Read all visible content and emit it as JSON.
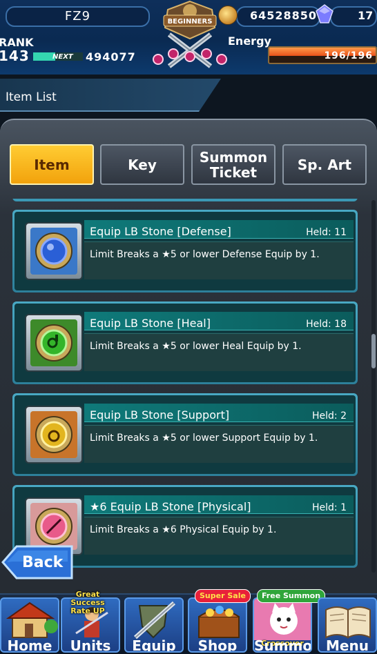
{
  "header": {
    "player_name": "FZ9",
    "emblem_text": "BEGINNERS",
    "coins": "64528850",
    "gems": "17",
    "rank_label": "RANK",
    "rank_value": "143",
    "next_label": "NEXT",
    "next_value": "494077",
    "next_progress": 0.45,
    "energy_label": "Energy",
    "energy_value": "196/196",
    "energy_progress": 1.0
  },
  "title": "Item List",
  "tabs": [
    {
      "label": "Item",
      "active": true
    },
    {
      "label": "Key",
      "active": false
    },
    {
      "label": "Summon\nTicket",
      "active": false
    },
    {
      "label": "Sp. Art",
      "active": false
    }
  ],
  "items": [
    {
      "name": "Equip LB Stone [Defense]",
      "held": "Held: 11",
      "desc": "Limit Breaks a ★5 or lower Defense Equip by 1.",
      "icon": "blue-stone-icon",
      "color": "#2a5fd6"
    },
    {
      "name": "Equip LB Stone [Heal]",
      "held": "Held: 18",
      "desc": "Limit Breaks a ★5 or lower Heal Equip by 1.",
      "icon": "green-stone-icon",
      "color": "#34b52a"
    },
    {
      "name": "Equip LB Stone [Support]",
      "held": "Held: 2",
      "desc": "Limit Breaks a ★5 or lower Support Equip by 1.",
      "icon": "yellow-stone-icon",
      "color": "#e2b51f"
    },
    {
      "name": "★6 Equip LB Stone [Physical]",
      "held": "Held: 1",
      "desc": "Limit Breaks a ★6 Physical Equip by 1.",
      "icon": "pink-stone-icon",
      "color": "#e85a8a"
    }
  ],
  "back_label": "Back",
  "nav": [
    {
      "label": "Home",
      "badge": ""
    },
    {
      "label": "Units",
      "badge": "Great Success Rate UP"
    },
    {
      "label": "Equip",
      "badge": ""
    },
    {
      "label": "Shop",
      "badge": "Super Sale"
    },
    {
      "label": "Summon",
      "badge": "Free Summon",
      "sub": "Crossover"
    },
    {
      "label": "Menu",
      "badge": ""
    }
  ]
}
